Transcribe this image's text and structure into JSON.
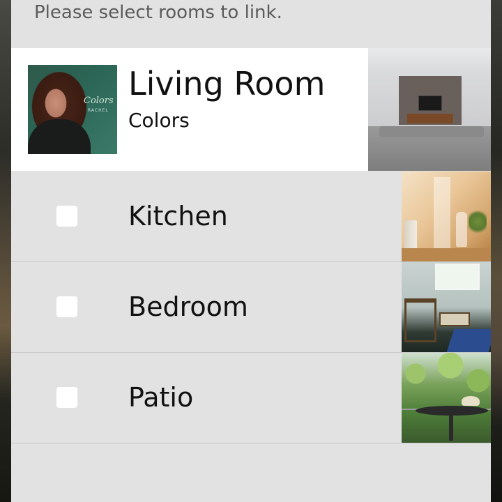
{
  "prompt": "Please select rooms to link.",
  "selected_room": {
    "name": "Living Room",
    "now_playing": "Colors",
    "album_art_text": "Colors",
    "album_art_artist": "RACHEL"
  },
  "rooms": [
    {
      "name": "Kitchen",
      "checked": false
    },
    {
      "name": "Bedroom",
      "checked": false
    },
    {
      "name": "Patio",
      "checked": false
    }
  ],
  "colors": {
    "dialog_bg": "#e2e2e2",
    "selected_row_bg": "#ffffff",
    "divider": "#c8c8c8",
    "checkbox": "#ffffff"
  },
  "icons": {
    "room_photo_living": "living-room-photo",
    "room_photo_kitchen": "kitchen-photo",
    "room_photo_bedroom": "bedroom-photo",
    "room_photo_patio": "patio-photo"
  }
}
